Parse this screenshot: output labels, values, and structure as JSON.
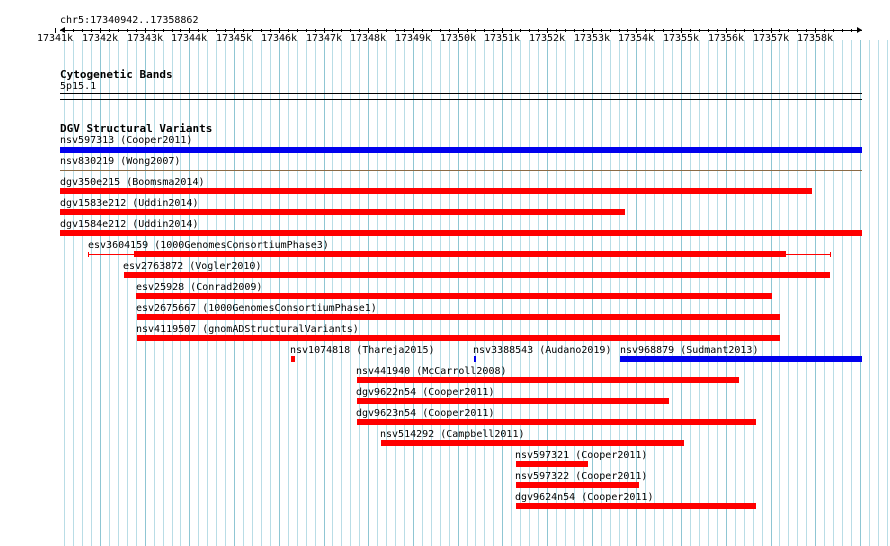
{
  "ruler": {
    "location": "chr5:17340942..17358862",
    "ticks": [
      "17341k",
      "17342k",
      "17343k",
      "17344k",
      "17345k",
      "17346k",
      "17347k",
      "17348k",
      "17349k",
      "17350k",
      "17351k",
      "17352k",
      "17353k",
      "17354k",
      "17355k",
      "17356k",
      "17357k",
      "17358k"
    ]
  },
  "cytoband": {
    "title": "Cytogenetic Bands",
    "band": "5p15.1"
  },
  "dgv": {
    "title": "DGV Structural Variants",
    "colors": {
      "loss": "#ff0000",
      "gain": "#0000ee"
    },
    "features": [
      {
        "label": "nsv597313 (Cooper2011)",
        "type": "gain"
      },
      {
        "label": "nsv830219 (Wong2007)",
        "type": "loss"
      },
      {
        "label": "dgv350e215 (Boomsma2014)",
        "type": "loss"
      },
      {
        "label": "dgv1583e212 (Uddin2014)",
        "type": "loss"
      },
      {
        "label": "dgv1584e212 (Uddin2014)",
        "type": "loss"
      },
      {
        "label": "esv3604159 (1000GenomesConsortiumPhase3)",
        "type": "loss"
      },
      {
        "label": "esv2763872 (Vogler2010)",
        "type": "loss"
      },
      {
        "label": "esv25928 (Conrad2009)",
        "type": "loss"
      },
      {
        "label": "esv2675667 (1000GenomesConsortiumPhase1)",
        "type": "loss"
      },
      {
        "label": "nsv4119507 (gnomADStructuralVariants)",
        "type": "loss"
      },
      {
        "label": "nsv1074818 (Thareja2015)",
        "type": "loss"
      },
      {
        "label": "nsv3388543 (Audano2019)",
        "type": "gain"
      },
      {
        "label": "nsv968879 (Sudmant2013)",
        "type": "gain"
      },
      {
        "label": "nsv441940 (McCarroll2008)",
        "type": "loss"
      },
      {
        "label": "dgv9622n54 (Cooper2011)",
        "type": "loss"
      },
      {
        "label": "dgv9623n54 (Cooper2011)",
        "type": "loss"
      },
      {
        "label": "nsv514292 (Campbell2011)",
        "type": "loss"
      },
      {
        "label": "nsv597321 (Cooper2011)",
        "type": "loss"
      },
      {
        "label": "nsv597322 (Cooper2011)",
        "type": "loss"
      },
      {
        "label": "dgv9624n54 (Cooper2011)",
        "type": "loss"
      }
    ]
  }
}
